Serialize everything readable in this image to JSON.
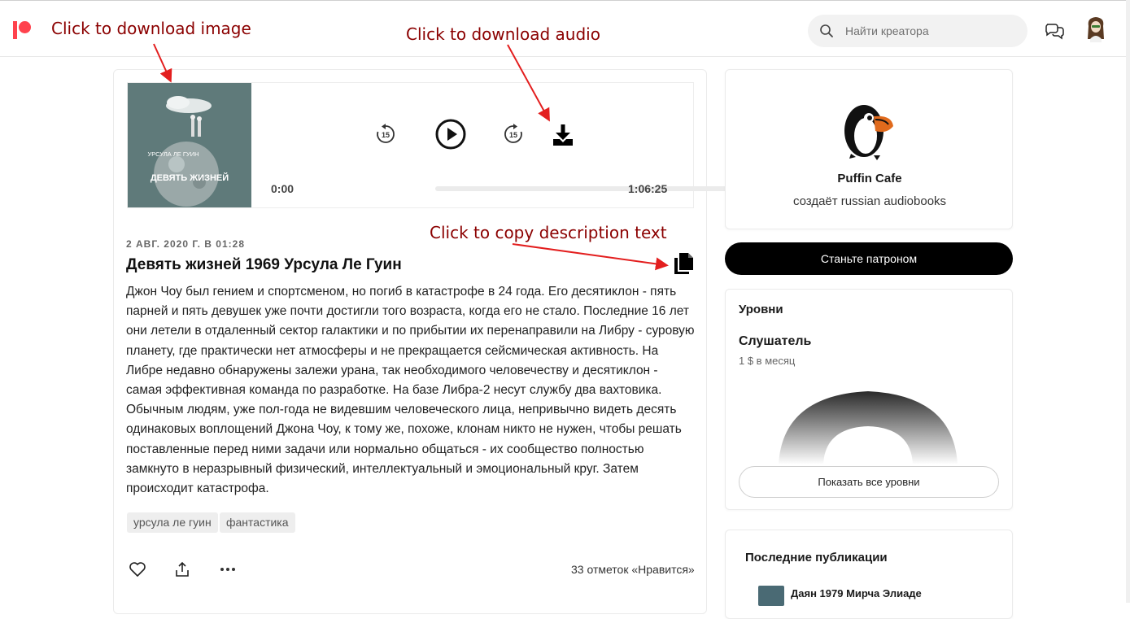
{
  "header": {
    "search_placeholder": "Найти креатора"
  },
  "annotations": {
    "download_image": "Click to download image",
    "download_audio": "Click to download audio",
    "copy_description": "Click to copy description text"
  },
  "player": {
    "cover_author": "УРСУЛА ЛЕ ГУИН",
    "cover_title": "ДЕВЯТЬ ЖИЗНЕЙ",
    "time_current": "0:00",
    "time_total": "1:06:25",
    "skip_seconds": "15",
    "progress": 0
  },
  "post": {
    "date": "2 АВГ. 2020 Г. В 01:28",
    "title": "Девять жизней 1969 Урсула Ле Гуин",
    "body": " Джон Чоу был гением и спортсменом, но погиб в катастрофе в 24 года. Его десятиклон - пять парней и пять девушек уже почти достигли того возраста, когда его не стало. Последние 16 лет они летели в отдаленный сектор галактики и по прибытии их перенаправили на Либру - суровую планету, где практически нет атмосферы и не прекращается сейсмическая активность. На Либре недавно обнаружены залежи урана, так необходимого человечеству и десятиклон - самая эффективная команда по разработке. На базе Либра-2 несут службу два вахтовика. Обычным людям, уже пол-года не видевшим человеческого лица, непривычно видеть десять одинаковых воплощений Джона Чоу, к тому же, похоже, клонам никто не нужен, чтобы решать поставленные перед ними задачи или нормально общаться - их сообщество полностью замкнуто в неразрывный физический, интеллектуальный и эмоциональный круг. Затем происходит катастрофа.",
    "tags": [
      "урсула ле гуин",
      "фантастика"
    ],
    "likes": "33 отметок «Нравится»"
  },
  "creator": {
    "name": "Puffin Cafe",
    "subtitle": "создаёт russian audiobooks",
    "become_patron": "Станьте патроном"
  },
  "levels": {
    "title": "Уровни",
    "tier_name": "Слушатель",
    "tier_price": "1 $ в месяц",
    "show_all": "Показать все уровни"
  },
  "recent": {
    "title": "Последние публикации",
    "item_title": "Даян 1979 Мирча Элиаде"
  },
  "colors": {
    "brand": "#ff424d",
    "annotation": "#8b0000",
    "arrow": "#e31e1e"
  }
}
